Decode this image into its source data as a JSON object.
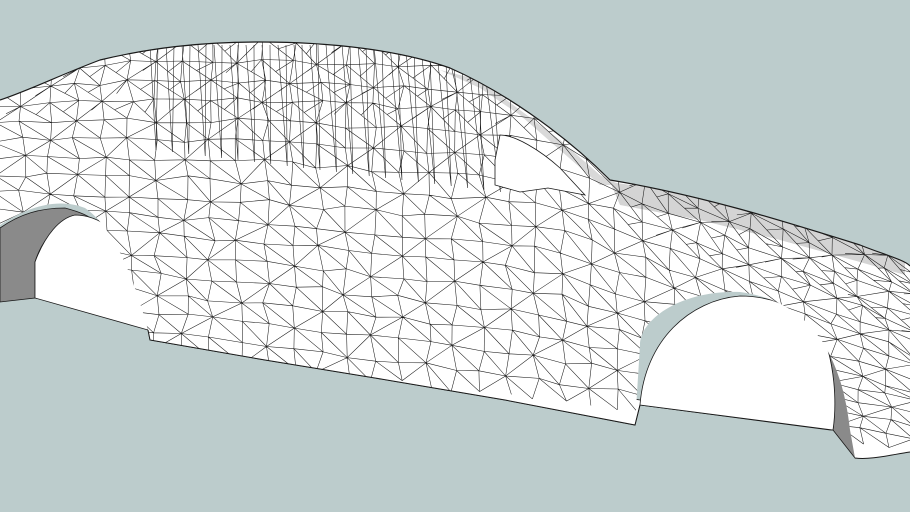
{
  "scene": {
    "subject": "car-body-mesh",
    "colors": {
      "background": "#bccccc",
      "surface": "#ffffff",
      "shadow": "#8a8a8a",
      "shadow_light": "#c8c8c8",
      "edge": "#1a1a1a"
    }
  }
}
